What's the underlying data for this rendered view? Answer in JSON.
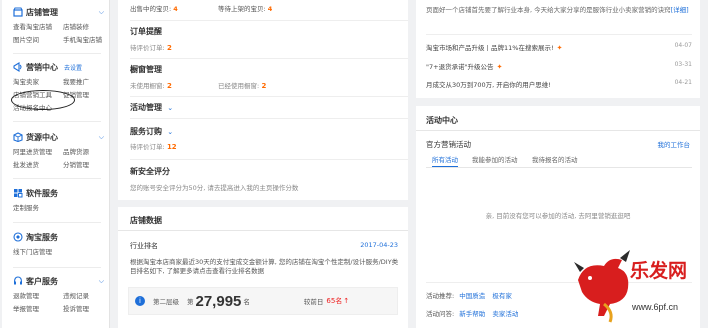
{
  "sidebar": {
    "sections": [
      {
        "id": "store",
        "title": "店铺管理",
        "extra": "",
        "links": [
          "查看淘宝店铺",
          "店铺装修",
          "图片空间",
          "手机淘宝店铺"
        ]
      },
      {
        "id": "marketing",
        "title": "营销中心",
        "extra": "去设置",
        "links": [
          "淘宝卖家",
          "我要推广",
          "店铺营销工具",
          "促销管理",
          "活动报名中心",
          ""
        ]
      },
      {
        "id": "goods",
        "title": "货源中心",
        "extra": "",
        "links": [
          "阿里进货管理",
          "品牌货源",
          "批发进货",
          "分销管理"
        ]
      },
      {
        "id": "software",
        "title": "软件服务",
        "extra": "",
        "links": [
          "定制服务"
        ]
      },
      {
        "id": "taoservice",
        "title": "淘宝服务",
        "extra": "",
        "links": [
          "线下门店管理"
        ]
      },
      {
        "id": "customer",
        "title": "客户服务",
        "extra": "",
        "links": [
          "退款管理",
          "违规记录",
          "举报管理",
          "投诉管理"
        ]
      }
    ]
  },
  "middle": {
    "top_row": {
      "left_label": "出售中的宝贝:",
      "left_value": "4",
      "right_label": "等待上架的宝贝:",
      "right_value": "4"
    },
    "order_reminder": {
      "title": "订单提醒",
      "label": "待评价订单:",
      "value": "2"
    },
    "warehouse": {
      "title": "橱窗管理",
      "left_label": "未使用橱窗:",
      "left_value": "2",
      "right_label": "已经使用橱窗:",
      "right_value": "2"
    },
    "activity": {
      "title": "活动管理",
      "chev": "⌄"
    },
    "service_orders": {
      "title": "服务订购",
      "chev": "⌄",
      "label": "待评价订单:",
      "value": "12"
    },
    "security": {
      "title": "新安全评分",
      "text": "您的账号安全评分为50分, 请去提高进入我的主页操作分数"
    },
    "store_data": {
      "title": "店铺数据",
      "rank_label": "行业排名",
      "rank_date": "2017-04-23",
      "rank_desc": "根据淘宝本店商家最近30天的支付宝成交金额计算, 您的店铺在淘宝个性定制/设计服务/DIY类目排名如下, 了解更多请点击查看行业排名数据",
      "tier": "第二层级",
      "amount_prefix": "第",
      "amount": "27,995",
      "amount_suffix": "名",
      "compare_label": "较前日",
      "compare_value": "65名",
      "compare_arrow": "↑"
    }
  },
  "right": {
    "intro": "页面好一个店铺首先要了解行业本身, 今天给大家分享的是服饰行业小卖家营销的诀窍",
    "intro_link": "[详细]",
    "news": [
      {
        "title": "淘宝市场和产品升级丨品牌11%在搜索展示!",
        "date": "04-07"
      },
      {
        "title": "\"7+退货承诺\"升级公告",
        "date": "03-31"
      },
      {
        "title": "月成交从30万到700万, 开启你的用户思维!",
        "date": "04-21"
      }
    ],
    "activity_center": {
      "title": "活动中心",
      "official": "官方营销活动",
      "my_workbench": "我的工作台",
      "tabs": [
        "所有活动",
        "我能参加的活动",
        "我待报名的活动"
      ],
      "empty_text": "亲, 目前没有您可以参加的活动, 去阿里营销逛逛吧",
      "footer_label1": "活动推荐:",
      "footer_links1": [
        "中国质造",
        "极有家"
      ],
      "footer_label2": "活动问答:",
      "footer_links2": [
        "新手帮助",
        "卖家活动"
      ]
    }
  },
  "watermark": {
    "text_cn": "乐发网",
    "url": "www.6pf.cn"
  },
  "colors": {
    "accent": "#1e6fd9",
    "orange": "#ff6a00",
    "bg": "#f0f1f3"
  }
}
